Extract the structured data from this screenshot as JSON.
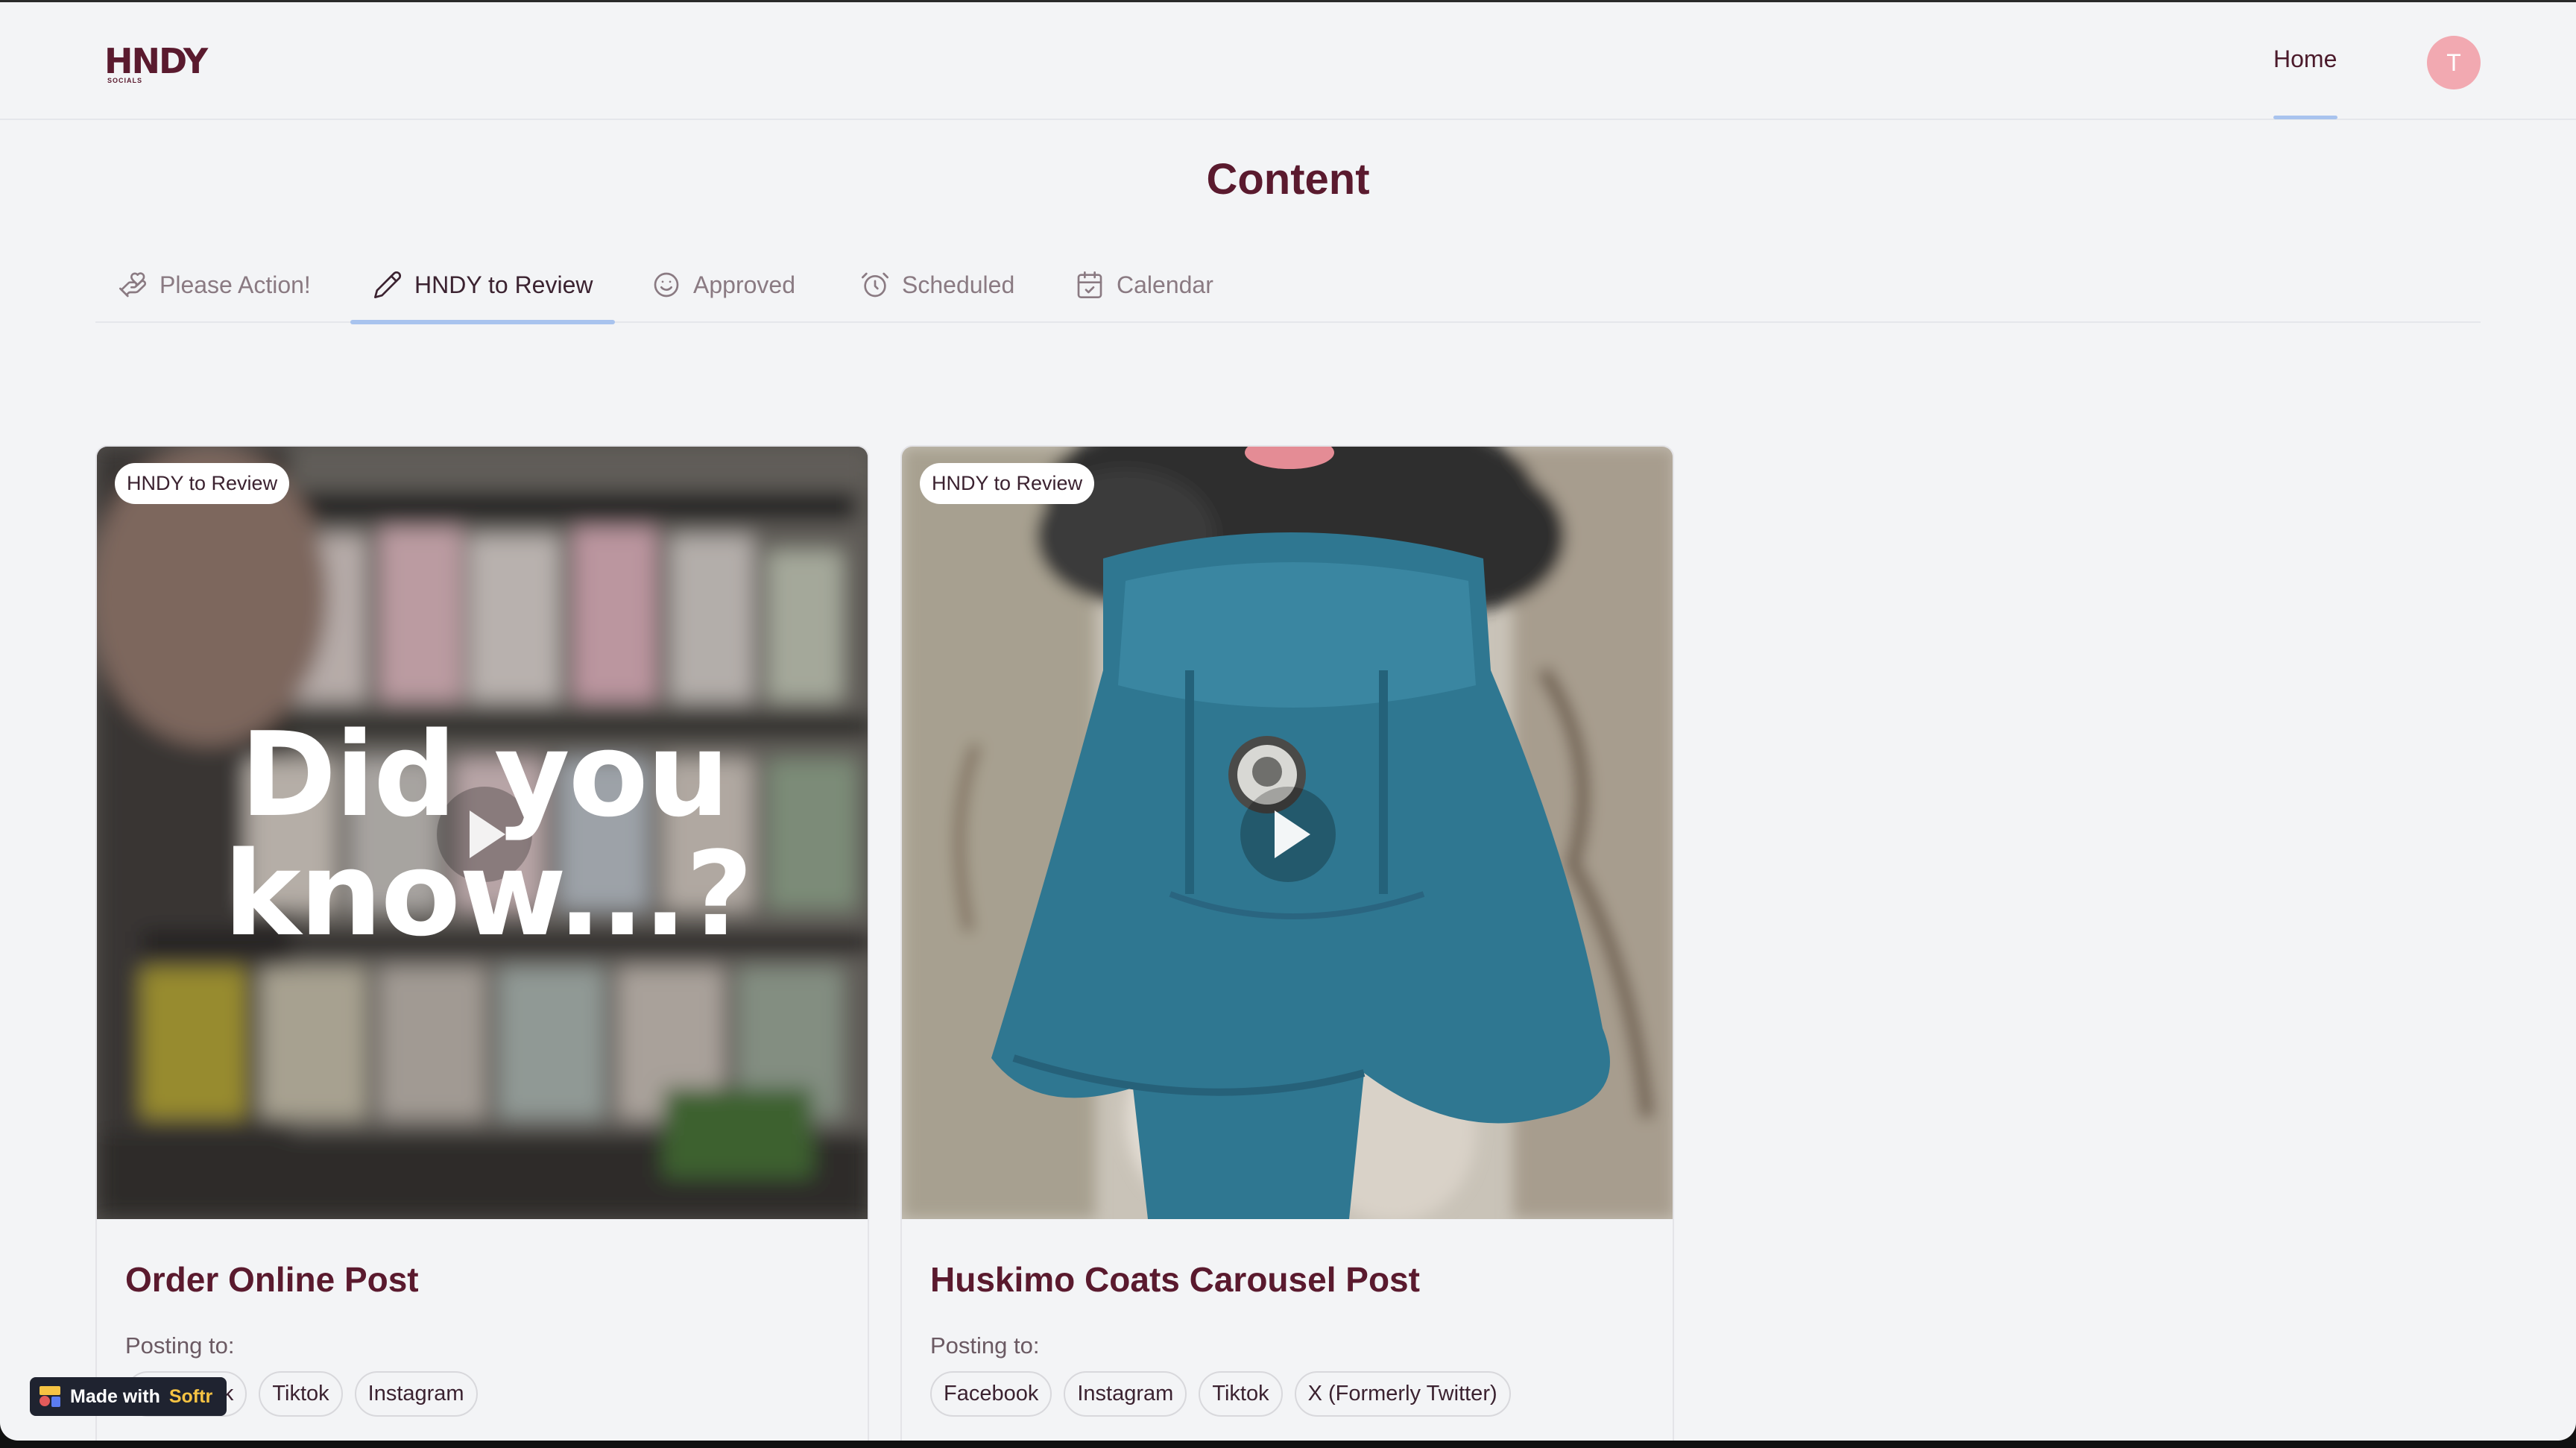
{
  "header": {
    "logo_text": "HNDY",
    "logo_subtext": "SOCIALS",
    "nav_home": "Home",
    "avatar_initial": "T"
  },
  "page": {
    "title": "Content"
  },
  "tabs": [
    {
      "label": "Please Action!",
      "icon": "hand-heart-icon"
    },
    {
      "label": "HNDY to Review",
      "icon": "pencil-icon",
      "active": true
    },
    {
      "label": "Approved",
      "icon": "smiley-icon"
    },
    {
      "label": "Scheduled",
      "icon": "alarm-clock-icon"
    },
    {
      "label": "Calendar",
      "icon": "calendar-icon"
    }
  ],
  "cards": [
    {
      "badge": "HNDY to Review",
      "media_text_line1": "Did you",
      "media_text_line2": "know...?",
      "title": "Order Online Post",
      "posting_label": "Posting to:",
      "platforms": [
        "Facebook",
        "Tiktok",
        "Instagram"
      ]
    },
    {
      "badge": "HNDY to Review",
      "title": "Huskimo Coats Carousel Post",
      "posting_label": "Posting to:",
      "platforms": [
        "Facebook",
        "Instagram",
        "Tiktok",
        "X (Formerly Twitter)"
      ]
    }
  ],
  "footer": {
    "made_with": "Made with",
    "brand": "Softr"
  },
  "colors": {
    "brand": "#5a1a2e",
    "accent_underline": "#a8c3ee",
    "avatar": "#f2a9b1",
    "background": "#f3f4f6"
  }
}
